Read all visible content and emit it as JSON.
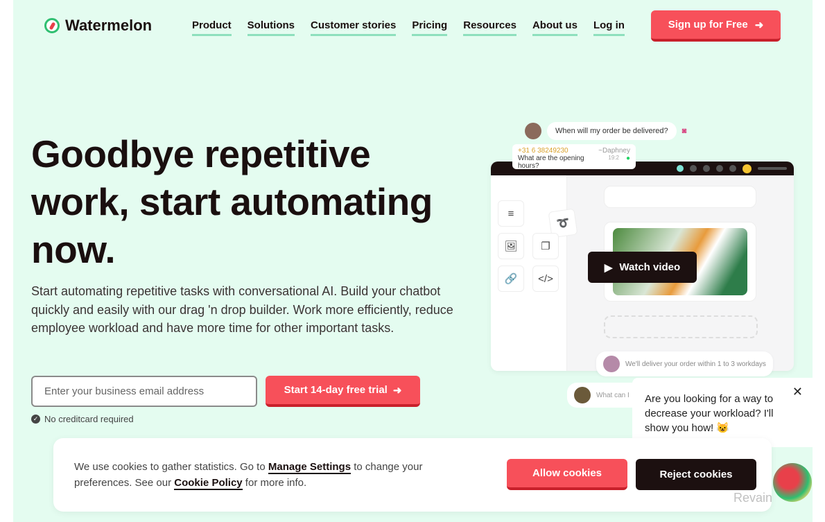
{
  "brand": {
    "name": "Watermelon",
    "accent": "#f7505a",
    "dark": "#1c1010",
    "background": "#e4fcf0"
  },
  "nav": {
    "items": [
      "Product",
      "Solutions",
      "Customer stories",
      "Pricing",
      "Resources",
      "About us",
      "Log in"
    ],
    "signup_label": "Sign up for Free"
  },
  "hero": {
    "title": "Goodbye repetitive work, start automating now.",
    "subtitle": "Start automating repetitive tasks with conversational AI. Build your chatbot quickly and easily with our drag 'n drop builder. Work more efficiently, reduce employee workload and have more time for other important tasks.",
    "email_placeholder": "Enter your business email address",
    "trial_label": "Start 14-day free trial",
    "no_cc": "No creditcard required"
  },
  "mockup": {
    "q1": "When will my order be delivered?",
    "phone": "+31 6 38249230",
    "sender": "~Daphney",
    "q2": "What are the opening hours?",
    "time": "19:2",
    "watch": "Watch video",
    "answer": "We'll deliver your order within 1 to 3 workdays",
    "partial": "What can I"
  },
  "chat": {
    "message": "Are you looking for a way to decrease your workload? I'll show you how! 😺"
  },
  "cookie": {
    "text1": "We use cookies to gather statistics. Go to ",
    "manage": "Manage Settings",
    "text2": " to change your preferences. See our ",
    "policy": "Cookie Policy",
    "text3": " for more info.",
    "allow": "Allow cookies",
    "reject": "Reject cookies"
  },
  "watermark": "Revain"
}
